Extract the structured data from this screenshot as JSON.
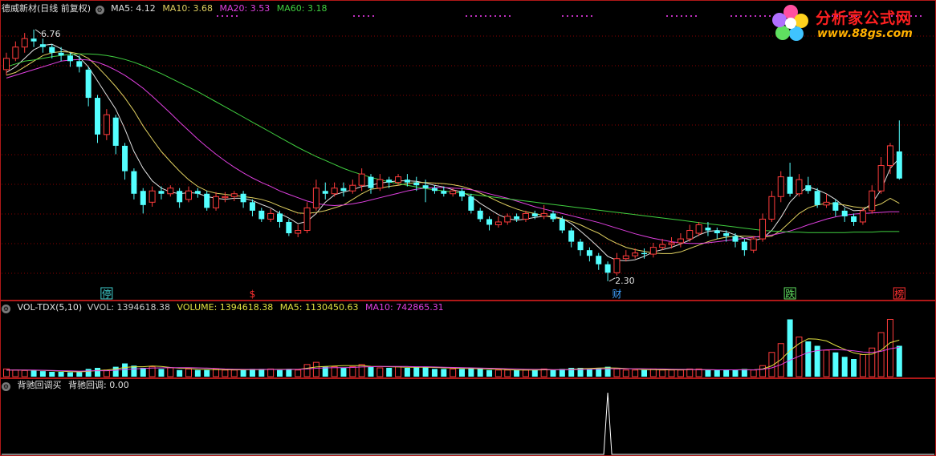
{
  "main": {
    "stock_name": "德威新材(日线 前复权)",
    "settings_icon": "gear-icon",
    "ma": [
      {
        "label": "MA5: 4.12",
        "color": "#e0e0e0"
      },
      {
        "label": "MA10: 3.68",
        "color": "#e0d060"
      },
      {
        "label": "MA20: 3.53",
        "color": "#e040e0"
      },
      {
        "label": "MA60: 3.18",
        "color": "#40d040"
      }
    ],
    "high_label": "6.76",
    "low_label": "2.30",
    "markers": [
      {
        "text": "停",
        "bar": 11,
        "color": "#40d0d0",
        "boxed": true
      },
      {
        "text": "$",
        "bar": 27,
        "color": "#ff3030",
        "boxed": false
      },
      {
        "text": "财",
        "bar": 67,
        "color": "#40a0ff",
        "boxed": false
      },
      {
        "text": "跌",
        "bar": 86,
        "color": "#60e060",
        "boxed": true
      },
      {
        "text": "榜",
        "bar": 98,
        "color": "#ff3030",
        "boxed": true
      }
    ]
  },
  "volume": {
    "title": "VOL-TDX(5,10)",
    "vvol": "VVOL: 1394618.38",
    "volume": "VOLUME: 1394618.38",
    "ma5": "MA5: 1130450.63",
    "ma10": "MA10: 742865.31",
    "colors": {
      "vvol": "#c8c8c8",
      "volume": "#e0e040",
      "ma5": "#e0e040",
      "ma10": "#e040e0"
    }
  },
  "indicator": {
    "title": "背驰回调买",
    "value": "背驰回调: 0.00"
  },
  "logo": {
    "brand": "分析家公式网",
    "url": "www.88gs.com"
  },
  "colors": {
    "up": "#ff3c3c",
    "down": "#54ffff",
    "grid": "#8b0000",
    "frame": "#b01818"
  },
  "chart_data": {
    "type": "candlestick",
    "price_range": [
      2.0,
      7.0
    ],
    "candles": [
      [
        6.05,
        6.25,
        6.35,
        5.95
      ],
      [
        6.25,
        6.45,
        6.55,
        6.2
      ],
      [
        6.45,
        6.6,
        6.7,
        6.35
      ],
      [
        6.6,
        6.55,
        6.76,
        6.45
      ],
      [
        6.5,
        6.45,
        6.6,
        6.35
      ],
      [
        6.45,
        6.35,
        6.5,
        6.25
      ],
      [
        6.35,
        6.3,
        6.45,
        6.2
      ],
      [
        6.3,
        6.2,
        6.35,
        6.1
      ],
      [
        6.2,
        6.1,
        6.3,
        6.0
      ],
      [
        6.05,
        5.55,
        6.1,
        5.4
      ],
      [
        5.55,
        4.9,
        5.6,
        4.75
      ],
      [
        4.9,
        5.25,
        5.35,
        4.8
      ],
      [
        5.2,
        4.7,
        5.25,
        4.55
      ],
      [
        4.7,
        4.25,
        4.75,
        4.1
      ],
      [
        4.25,
        3.85,
        4.3,
        3.75
      ],
      [
        3.9,
        3.65,
        3.95,
        3.5
      ],
      [
        3.7,
        3.9,
        3.98,
        3.62
      ],
      [
        3.9,
        3.85,
        3.98,
        3.75
      ],
      [
        3.85,
        3.95,
        4.0,
        3.8
      ],
      [
        3.9,
        3.7,
        3.95,
        3.6
      ],
      [
        3.75,
        3.9,
        3.98,
        3.7
      ],
      [
        3.9,
        3.85,
        3.95,
        3.78
      ],
      [
        3.85,
        3.6,
        3.9,
        3.55
      ],
      [
        3.6,
        3.8,
        3.88,
        3.55
      ],
      [
        3.78,
        3.8,
        3.88,
        3.7
      ],
      [
        3.8,
        3.85,
        3.9,
        3.72
      ],
      [
        3.85,
        3.7,
        3.9,
        3.6
      ],
      [
        3.7,
        3.55,
        3.75,
        3.45
      ],
      [
        3.55,
        3.4,
        3.6,
        3.35
      ],
      [
        3.4,
        3.5,
        3.58,
        3.35
      ],
      [
        3.5,
        3.35,
        3.55,
        3.25
      ],
      [
        3.35,
        3.15,
        3.4,
        3.1
      ],
      [
        3.15,
        3.2,
        3.3,
        3.08
      ],
      [
        3.2,
        3.6,
        3.7,
        3.15
      ],
      [
        3.6,
        3.95,
        4.1,
        3.55
      ],
      [
        3.9,
        3.85,
        4.05,
        3.75
      ],
      [
        3.85,
        3.95,
        4.05,
        3.8
      ],
      [
        3.95,
        3.9,
        4.05,
        3.8
      ],
      [
        3.9,
        4.0,
        4.1,
        3.85
      ],
      [
        4.0,
        4.2,
        4.3,
        3.9
      ],
      [
        4.15,
        3.95,
        4.2,
        3.85
      ],
      [
        3.95,
        4.1,
        4.2,
        3.9
      ],
      [
        4.1,
        4.05,
        4.15,
        3.95
      ],
      [
        4.05,
        4.15,
        4.2,
        4.0
      ],
      [
        4.1,
        4.05,
        4.2,
        3.98
      ],
      [
        4.05,
        4.0,
        4.15,
        3.9
      ],
      [
        4.0,
        3.95,
        4.1,
        3.7
      ],
      [
        3.95,
        3.9,
        4.0,
        3.85
      ],
      [
        3.9,
        3.85,
        3.98,
        3.8
      ],
      [
        3.85,
        3.9,
        3.95,
        3.8
      ],
      [
        3.9,
        3.8,
        3.95,
        3.72
      ],
      [
        3.8,
        3.55,
        3.85,
        3.5
      ],
      [
        3.55,
        3.4,
        3.6,
        3.35
      ],
      [
        3.4,
        3.3,
        3.45,
        3.2
      ],
      [
        3.3,
        3.35,
        3.45,
        3.25
      ],
      [
        3.35,
        3.45,
        3.5,
        3.3
      ],
      [
        3.45,
        3.4,
        3.5,
        3.35
      ],
      [
        3.4,
        3.5,
        3.55,
        3.35
      ],
      [
        3.5,
        3.45,
        3.55,
        3.4
      ],
      [
        3.45,
        3.5,
        3.65,
        3.4
      ],
      [
        3.5,
        3.4,
        3.55,
        3.35
      ],
      [
        3.4,
        3.2,
        3.45,
        3.15
      ],
      [
        3.2,
        3.0,
        3.25,
        2.9
      ],
      [
        3.0,
        2.85,
        3.05,
        2.75
      ],
      [
        2.85,
        2.75,
        2.9,
        2.65
      ],
      [
        2.75,
        2.6,
        2.8,
        2.5
      ],
      [
        2.6,
        2.45,
        2.65,
        2.3
      ],
      [
        2.45,
        2.7,
        2.8,
        2.4
      ],
      [
        2.7,
        2.75,
        2.85,
        2.65
      ],
      [
        2.75,
        2.8,
        2.88,
        2.7
      ],
      [
        2.8,
        2.78,
        2.88,
        2.7
      ],
      [
        2.78,
        2.9,
        2.98,
        2.72
      ],
      [
        2.9,
        2.95,
        3.05,
        2.85
      ],
      [
        2.95,
        2.98,
        3.08,
        2.88
      ],
      [
        2.98,
        3.05,
        3.15,
        2.9
      ],
      [
        3.05,
        3.2,
        3.3,
        3.0
      ],
      [
        3.15,
        3.3,
        3.35,
        3.1
      ],
      [
        3.25,
        3.2,
        3.35,
        3.1
      ],
      [
        3.2,
        3.15,
        3.25,
        3.05
      ],
      [
        3.15,
        3.1,
        3.2,
        3.0
      ],
      [
        3.1,
        3.0,
        3.15,
        2.9
      ],
      [
        3.0,
        2.85,
        3.05,
        2.75
      ],
      [
        2.85,
        3.05,
        3.1,
        2.8
      ],
      [
        3.05,
        3.4,
        3.5,
        3.0
      ],
      [
        3.4,
        3.8,
        3.9,
        3.35
      ],
      [
        3.8,
        4.15,
        4.25,
        3.7
      ],
      [
        4.15,
        3.85,
        4.4,
        3.8
      ],
      [
        3.85,
        4.1,
        4.2,
        3.8
      ],
      [
        4.0,
        3.9,
        4.15,
        3.85
      ],
      [
        3.9,
        3.65,
        3.95,
        3.6
      ],
      [
        3.65,
        3.7,
        3.85,
        3.6
      ],
      [
        3.7,
        3.55,
        3.75,
        3.45
      ],
      [
        3.55,
        3.45,
        3.6,
        3.35
      ],
      [
        3.45,
        3.35,
        3.5,
        3.28
      ],
      [
        3.35,
        3.55,
        3.6,
        3.3
      ],
      [
        3.55,
        3.9,
        4.0,
        3.5
      ],
      [
        3.9,
        4.35,
        4.5,
        3.85
      ],
      [
        4.35,
        4.7,
        4.75,
        4.2
      ],
      [
        4.6,
        4.12,
        5.15,
        4.1
      ]
    ],
    "ma_series": {
      "MA5": [
        6.0,
        6.1,
        6.25,
        6.4,
        6.48,
        6.5,
        6.42,
        6.35,
        6.27,
        6.1,
        5.85,
        5.6,
        5.35,
        5.0,
        4.6,
        4.3,
        4.08,
        3.95,
        3.88,
        3.85,
        3.87,
        3.86,
        3.8,
        3.77,
        3.75,
        3.77,
        3.77,
        3.73,
        3.66,
        3.6,
        3.5,
        3.42,
        3.32,
        3.36,
        3.5,
        3.7,
        3.83,
        3.88,
        3.92,
        3.98,
        4.0,
        4.04,
        4.06,
        4.08,
        4.08,
        4.07,
        4.04,
        4.0,
        3.97,
        3.92,
        3.88,
        3.8,
        3.68,
        3.58,
        3.48,
        3.41,
        3.38,
        3.4,
        3.43,
        3.45,
        3.45,
        3.41,
        3.32,
        3.19,
        3.05,
        2.9,
        2.74,
        2.67,
        2.66,
        2.68,
        2.74,
        2.82,
        2.86,
        2.9,
        2.96,
        3.03,
        3.12,
        3.18,
        3.2,
        3.18,
        3.12,
        3.06,
        3.02,
        3.06,
        3.2,
        3.43,
        3.7,
        3.87,
        3.97,
        3.92,
        3.85,
        3.75,
        3.62,
        3.55,
        3.56,
        3.68,
        3.92,
        4.3,
        4.48
      ],
      "MA10": [
        5.95,
        6.0,
        6.1,
        6.2,
        6.3,
        6.35,
        6.37,
        6.36,
        6.33,
        6.25,
        6.1,
        5.93,
        5.75,
        5.55,
        5.32,
        5.05,
        4.82,
        4.6,
        4.42,
        4.25,
        4.1,
        3.98,
        3.9,
        3.86,
        3.84,
        3.82,
        3.8,
        3.78,
        3.75,
        3.7,
        3.63,
        3.57,
        3.51,
        3.5,
        3.52,
        3.55,
        3.6,
        3.65,
        3.75,
        3.85,
        3.93,
        3.95,
        3.98,
        4.0,
        4.03,
        4.05,
        4.05,
        4.04,
        4.03,
        4.01,
        3.98,
        3.93,
        3.86,
        3.79,
        3.71,
        3.64,
        3.58,
        3.53,
        3.5,
        3.46,
        3.43,
        3.4,
        3.36,
        3.3,
        3.22,
        3.15,
        3.05,
        2.97,
        2.9,
        2.86,
        2.83,
        2.8,
        2.79,
        2.79,
        2.82,
        2.88,
        2.94,
        3.0,
        3.05,
        3.08,
        3.1,
        3.1,
        3.09,
        3.08,
        3.1,
        3.2,
        3.35,
        3.5,
        3.6,
        3.65,
        3.68,
        3.67,
        3.65,
        3.62,
        3.6,
        3.62,
        3.67,
        3.77,
        3.68
      ],
      "MA20": [
        5.9,
        5.95,
        6.0,
        6.05,
        6.1,
        6.15,
        6.2,
        6.22,
        6.23,
        6.22,
        6.18,
        6.12,
        6.04,
        5.95,
        5.84,
        5.72,
        5.58,
        5.43,
        5.28,
        5.12,
        4.97,
        4.82,
        4.68,
        4.55,
        4.43,
        4.32,
        4.22,
        4.13,
        4.05,
        3.98,
        3.9,
        3.84,
        3.78,
        3.72,
        3.68,
        3.65,
        3.64,
        3.65,
        3.67,
        3.7,
        3.74,
        3.78,
        3.82,
        3.86,
        3.9,
        3.93,
        3.95,
        3.96,
        3.96,
        3.95,
        3.94,
        3.92,
        3.89,
        3.85,
        3.81,
        3.77,
        3.72,
        3.67,
        3.62,
        3.58,
        3.54,
        3.5,
        3.46,
        3.42,
        3.38,
        3.34,
        3.29,
        3.24,
        3.19,
        3.14,
        3.1,
        3.06,
        3.03,
        3.0,
        2.98,
        2.97,
        2.97,
        2.98,
        3.0,
        3.02,
        3.04,
        3.06,
        3.08,
        3.1,
        3.12,
        3.15,
        3.19,
        3.24,
        3.3,
        3.35,
        3.4,
        3.44,
        3.47,
        3.49,
        3.5,
        3.51,
        3.52,
        3.53,
        3.53
      ],
      "MA60": [
        6.1,
        6.15,
        6.2,
        6.22,
        6.25,
        6.28,
        6.3,
        6.32,
        6.33,
        6.33,
        6.32,
        6.3,
        6.27,
        6.23,
        6.18,
        6.12,
        6.05,
        5.98,
        5.9,
        5.82,
        5.74,
        5.66,
        5.57,
        5.48,
        5.39,
        5.3,
        5.21,
        5.12,
        5.03,
        4.94,
        4.85,
        4.76,
        4.67,
        4.59,
        4.51,
        4.44,
        4.37,
        4.3,
        4.24,
        4.19,
        4.14,
        4.1,
        4.06,
        4.03,
        4.0,
        3.97,
        3.94,
        3.92,
        3.9,
        3.88,
        3.86,
        3.84,
        3.82,
        3.8,
        3.78,
        3.76,
        3.74,
        3.72,
        3.7,
        3.68,
        3.66,
        3.64,
        3.62,
        3.6,
        3.58,
        3.56,
        3.54,
        3.52,
        3.5,
        3.48,
        3.46,
        3.44,
        3.42,
        3.4,
        3.38,
        3.36,
        3.34,
        3.32,
        3.3,
        3.28,
        3.26,
        3.24,
        3.22,
        3.2,
        3.19,
        3.18,
        3.17,
        3.17,
        3.16,
        3.16,
        3.16,
        3.16,
        3.16,
        3.17,
        3.17,
        3.17,
        3.18,
        3.18,
        3.18
      ]
    },
    "volume_values": [
      0.35,
      0.3,
      0.28,
      0.3,
      0.25,
      0.22,
      0.22,
      0.2,
      0.2,
      0.35,
      0.4,
      0.3,
      0.45,
      0.6,
      0.5,
      0.4,
      0.45,
      0.35,
      0.4,
      0.3,
      0.35,
      0.3,
      0.3,
      0.35,
      0.3,
      0.3,
      0.3,
      0.35,
      0.35,
      0.35,
      0.3,
      0.35,
      0.3,
      0.55,
      0.65,
      0.45,
      0.45,
      0.4,
      0.45,
      0.55,
      0.45,
      0.4,
      0.4,
      0.45,
      0.4,
      0.45,
      0.45,
      0.35,
      0.35,
      0.35,
      0.35,
      0.4,
      0.35,
      0.3,
      0.3,
      0.3,
      0.3,
      0.3,
      0.3,
      0.35,
      0.3,
      0.35,
      0.4,
      0.4,
      0.35,
      0.4,
      0.45,
      0.35,
      0.3,
      0.3,
      0.3,
      0.35,
      0.3,
      0.3,
      0.3,
      0.35,
      0.35,
      0.3,
      0.3,
      0.3,
      0.3,
      0.35,
      0.3,
      0.5,
      1.1,
      1.5,
      2.6,
      1.8,
      1.6,
      1.4,
      1.2,
      1.1,
      0.9,
      0.8,
      1.0,
      1.3,
      2.0,
      2.6,
      1.4
    ],
    "volume_ma5": [
      0.3,
      0.3,
      0.3,
      0.29,
      0.28,
      0.27,
      0.25,
      0.23,
      0.22,
      0.24,
      0.28,
      0.3,
      0.35,
      0.42,
      0.45,
      0.45,
      0.48,
      0.46,
      0.42,
      0.38,
      0.37,
      0.34,
      0.33,
      0.32,
      0.32,
      0.31,
      0.31,
      0.32,
      0.32,
      0.33,
      0.33,
      0.34,
      0.33,
      0.38,
      0.44,
      0.46,
      0.48,
      0.5,
      0.5,
      0.5,
      0.47,
      0.46,
      0.45,
      0.44,
      0.43,
      0.43,
      0.43,
      0.42,
      0.4,
      0.39,
      0.37,
      0.37,
      0.36,
      0.35,
      0.34,
      0.32,
      0.3,
      0.3,
      0.3,
      0.31,
      0.31,
      0.32,
      0.34,
      0.36,
      0.37,
      0.39,
      0.4,
      0.39,
      0.37,
      0.35,
      0.32,
      0.32,
      0.31,
      0.31,
      0.31,
      0.32,
      0.32,
      0.31,
      0.31,
      0.31,
      0.31,
      0.32,
      0.31,
      0.35,
      0.49,
      0.77,
      1.19,
      1.5,
      1.72,
      1.7,
      1.62,
      1.42,
      1.24,
      1.08,
      1.0,
      1.02,
      1.2,
      1.54,
      1.66
    ],
    "volume_ma10": [
      0.3,
      0.3,
      0.3,
      0.3,
      0.29,
      0.28,
      0.27,
      0.26,
      0.25,
      0.26,
      0.27,
      0.27,
      0.29,
      0.33,
      0.35,
      0.37,
      0.39,
      0.4,
      0.41,
      0.41,
      0.41,
      0.4,
      0.39,
      0.37,
      0.35,
      0.34,
      0.33,
      0.33,
      0.33,
      0.33,
      0.32,
      0.33,
      0.33,
      0.35,
      0.38,
      0.4,
      0.41,
      0.41,
      0.42,
      0.44,
      0.45,
      0.46,
      0.46,
      0.46,
      0.46,
      0.45,
      0.45,
      0.44,
      0.43,
      0.42,
      0.41,
      0.4,
      0.39,
      0.38,
      0.37,
      0.36,
      0.35,
      0.34,
      0.33,
      0.33,
      0.32,
      0.32,
      0.32,
      0.33,
      0.34,
      0.35,
      0.36,
      0.36,
      0.36,
      0.36,
      0.36,
      0.35,
      0.35,
      0.34,
      0.33,
      0.33,
      0.32,
      0.32,
      0.31,
      0.31,
      0.31,
      0.31,
      0.31,
      0.33,
      0.4,
      0.54,
      0.75,
      0.93,
      1.1,
      1.18,
      1.22,
      1.23,
      1.21,
      1.17,
      1.12,
      1.1,
      1.15,
      1.27,
      1.33
    ],
    "indicator_values": "zero except a single spike of 1 at candle 66 (low 2.30)"
  }
}
